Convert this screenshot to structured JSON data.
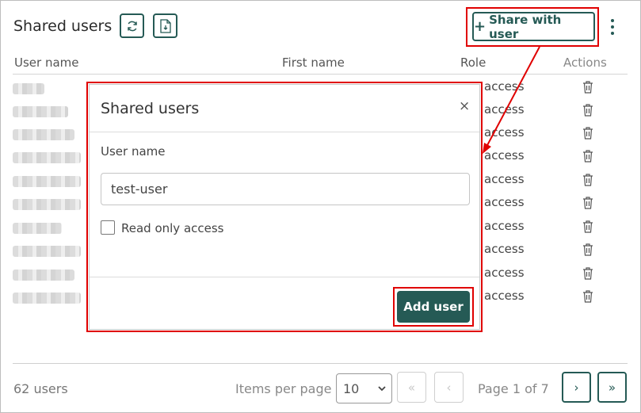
{
  "header": {
    "title": "Shared users",
    "share_label": "Share with user",
    "share_plus": "+"
  },
  "table": {
    "columns": [
      "User name",
      "First name",
      "Role",
      "Actions"
    ],
    "rows": [
      {
        "suffix": "",
        "role": "access"
      },
      {
        "suffix": "",
        "role": "access"
      },
      {
        "suffix": "",
        "role": "access"
      },
      {
        "suffix": "a",
        "role": "access"
      },
      {
        "suffix": "k",
        "role": "access"
      },
      {
        "suffix": "e",
        "role": "access"
      },
      {
        "suffix": "",
        "role": "access"
      },
      {
        "suffix": "a",
        "role": "access"
      },
      {
        "suffix": "",
        "role": "access"
      },
      {
        "suffix": "",
        "role": "access"
      }
    ]
  },
  "modal": {
    "title": "Shared users",
    "close": "×",
    "username_label": "User name",
    "username_value": "test-user",
    "readonly_label": "Read only access",
    "readonly_checked": false,
    "add_button": "Add user"
  },
  "footer": {
    "count": "62 users",
    "items_per_page_label": "Items per page",
    "items_per_page_value": "10",
    "first": "«",
    "prev": "‹",
    "page_info": "Page 1 of 7",
    "next": "›",
    "last": "»"
  },
  "colors": {
    "accent": "#255a55",
    "highlight": "#e00000"
  }
}
